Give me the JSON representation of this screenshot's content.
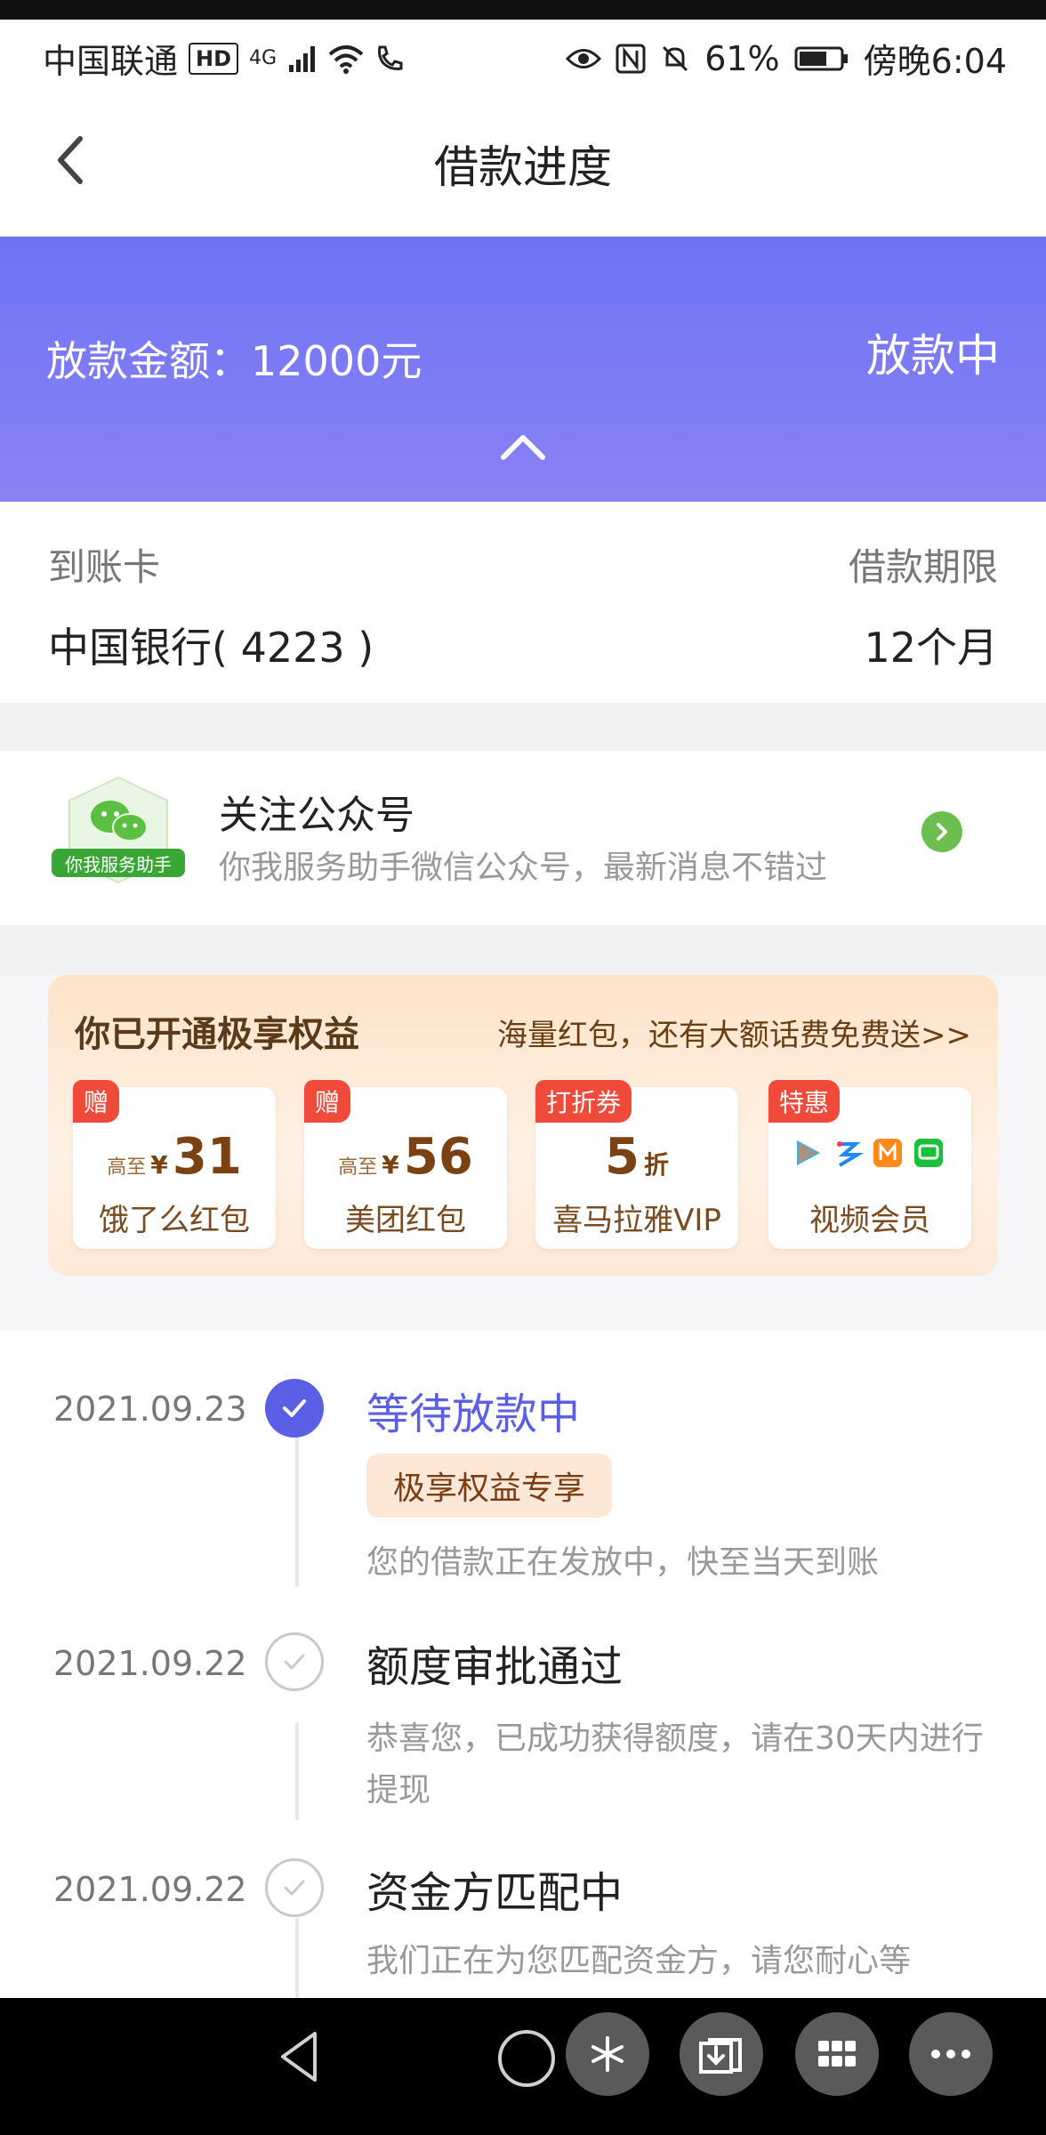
{
  "status_bar": {
    "carrier": "中国联通",
    "hd": "HD",
    "network": "4G",
    "battery": "61%",
    "time": "傍晚6:04"
  },
  "header": {
    "title": "借款进度"
  },
  "loan": {
    "amount_text": "放款金额：12000元",
    "status": "放款中"
  },
  "info": {
    "card_label": "到账卡",
    "term_label": "借款期限",
    "card_value": "中国银行( 4223 )",
    "term_value": "12个月"
  },
  "follow": {
    "logo_label": "你我服务助手",
    "title": "关注公众号",
    "subtitle": "你我服务助手微信公众号，最新消息不错过"
  },
  "benefits": {
    "title": "你已开通极享权益",
    "promo": "海量红包，还有大额话费免费送>>",
    "coupons": [
      {
        "tag": "赠",
        "prefix": "高至",
        "yen": "¥",
        "value": "31",
        "suffix": "",
        "name": "饿了么红包"
      },
      {
        "tag": "赠",
        "prefix": "高至",
        "yen": "¥",
        "value": "56",
        "suffix": "",
        "name": "美团红包"
      },
      {
        "tag": "打折券",
        "prefix": "",
        "yen": "",
        "value": "5",
        "suffix": "折",
        "name": "喜马拉雅VIP"
      },
      {
        "tag": "特惠",
        "prefix": "",
        "yen": "",
        "value": "",
        "suffix": "",
        "name": "视频会员"
      }
    ]
  },
  "timeline": [
    {
      "date": "2021.09.23",
      "title": "等待放款中",
      "badge": "极享权益专享",
      "desc": "您的借款正在发放中，快至当天到账",
      "active": true
    },
    {
      "date": "2021.09.22",
      "title": "额度审批通过",
      "desc": "恭喜您，已成功获得额度，请在30天内进行提现",
      "active": false
    },
    {
      "date": "2021.09.22",
      "title": "资金方匹配中",
      "desc": "我们正在为您匹配资金方，请您耐心等",
      "active": false
    }
  ],
  "colors": {
    "accent": "#5b5fe6",
    "banner": "#7b7cf4",
    "wechat_green": "#6cbf4f",
    "coupon_tag": "#f04a3a"
  }
}
